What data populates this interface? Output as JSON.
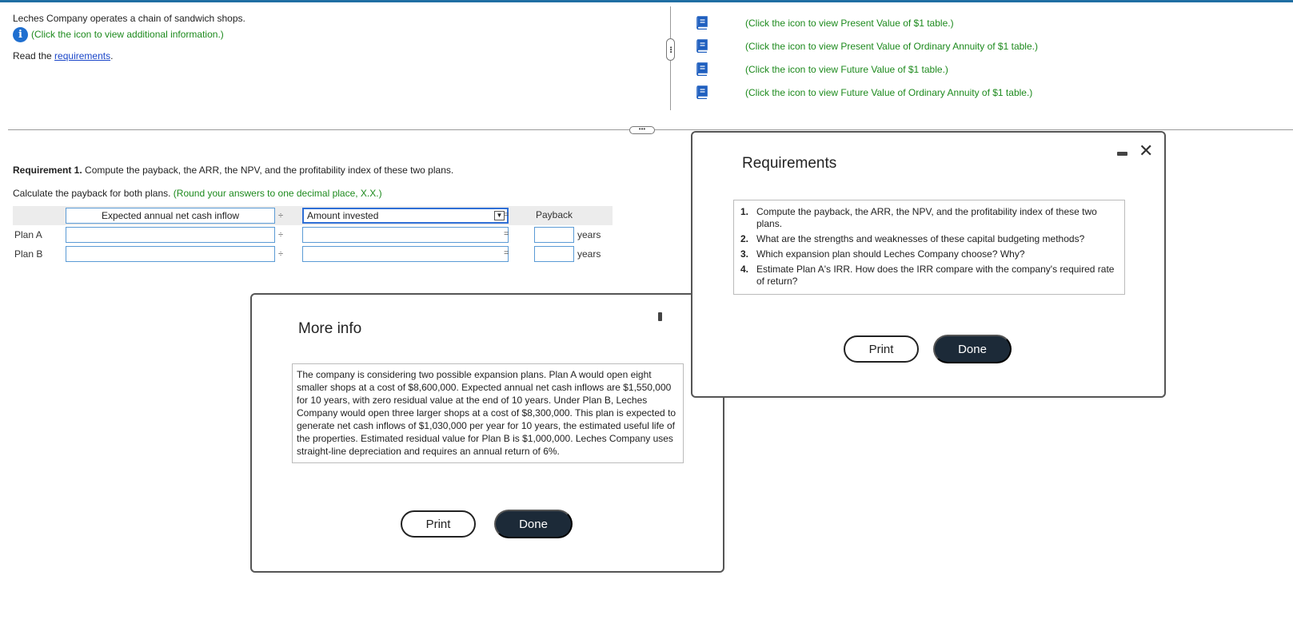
{
  "intro": {
    "company_line": "Leches Company operates a chain of sandwich shops.",
    "info_link": "(Click the icon to view additional information.)",
    "read_prefix": "Read the ",
    "read_link": "requirements",
    "read_suffix": "."
  },
  "tables": [
    {
      "label": "(Click the icon to view Present Value of $1 table.)",
      "icon": "book-icon"
    },
    {
      "label": "(Click the icon to view Present Value of Ordinary Annuity of $1 table.)",
      "icon": "book-icon"
    },
    {
      "label": "(Click the icon to view Future Value of $1 table.)",
      "icon": "book-icon"
    },
    {
      "label": "(Click the icon to view Future Value of Ordinary Annuity of $1 table.)",
      "icon": "book-icon"
    }
  ],
  "requirement1": {
    "bold": "Requirement 1.",
    "text": " Compute the payback, the ARR, the NPV, and the profitability index of these two plans.",
    "calc_text": "Calculate the payback for both plans. ",
    "round_note": "(Round your answers to one decimal place, X.X.)"
  },
  "calc_table": {
    "col1_header": "Expected annual net cash inflow",
    "col2_header": "Amount invested",
    "divide_symbol": "÷",
    "equals_symbol": "=",
    "col3_header": "Payback",
    "rows": [
      {
        "label": "Plan A",
        "col1_value": "",
        "col2_value": "",
        "payback_value": "",
        "unit": "years"
      },
      {
        "label": "Plan B",
        "col1_value": "",
        "col2_value": "",
        "payback_value": "",
        "unit": "years"
      }
    ]
  },
  "requirements_modal": {
    "title": "Requirements",
    "items": [
      {
        "num": "1.",
        "text": "Compute the payback, the ARR, the NPV, and the profitability index of these two plans."
      },
      {
        "num": "2.",
        "text": "What are the strengths and weaknesses of these capital budgeting methods?"
      },
      {
        "num": "3.",
        "text": "Which expansion plan should Leches Company choose? Why?"
      },
      {
        "num": "4.",
        "text": "Estimate Plan A's IRR. How does the IRR compare with the company's required rate of return?"
      }
    ],
    "print_label": "Print",
    "done_label": "Done"
  },
  "info_modal": {
    "title": "More info",
    "text": "The company is considering two possible expansion plans. Plan A would open eight smaller shops at a cost of $8,600,000. Expected annual net cash inflows are $1,550,000 for 10 years, with zero residual value at the end of 10 years. Under Plan B, Leches Company would open three larger shops at a cost of $8,300,000. This plan is expected to generate net cash inflows of $1,030,000 per year for 10 years, the estimated useful life of the properties. Estimated residual value for Plan B is $1,000,000. Leches Company uses straight-line depreciation and requires an annual return of 6%.",
    "print_label": "Print",
    "done_label": "Done"
  },
  "colors": {
    "green_text": "#1d8a1d",
    "link_blue": "#1a46c9",
    "info_icon": "#1f6fd0",
    "done_button": "#1c2a38"
  }
}
